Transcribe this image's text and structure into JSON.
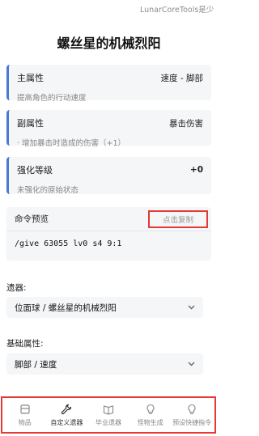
{
  "header": {
    "app_name": "LunarCoreTools是少",
    "title": "螺丝星的机械烈阳"
  },
  "cards": {
    "main_attr": {
      "label": "主属性",
      "value": "速度 - 脚部",
      "desc": "提高角色的行动速度"
    },
    "sub_attr": {
      "label": "副属性",
      "value": "暴击伤害",
      "desc": "· 增加暴击时造成的伤害（+1）"
    },
    "enhance": {
      "label": "强化等级",
      "value": "+0",
      "desc": "未强化的原始状态"
    }
  },
  "command": {
    "title": "命令预览",
    "copy_label": "点击复制",
    "text": "/give 63055 lv0 s4 9:1"
  },
  "relic_select": {
    "label": "遗器:",
    "value": "位面球 / 螺丝星的机械烈阳"
  },
  "base_attr_select": {
    "label": "基础属性:",
    "value": "脚部 / 速度"
  },
  "nav": {
    "items": [
      {
        "label": "物品",
        "icon": "box-icon"
      },
      {
        "label": "自定义遗器",
        "icon": "wrench-icon"
      },
      {
        "label": "毕业遗器",
        "icon": "book-icon"
      },
      {
        "label": "怪物生成",
        "icon": "bulb-icon"
      },
      {
        "label": "预设快捷指令",
        "icon": "lightbulb-icon"
      }
    ],
    "active_index": 1
  },
  "colors": {
    "accent": "#4a78d6",
    "highlight": "#e53935",
    "card_bg": "#f5f6f8"
  }
}
